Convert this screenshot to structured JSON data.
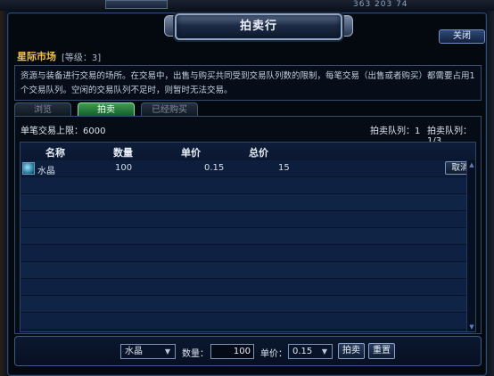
{
  "hud": {
    "values": "363   203   74"
  },
  "window": {
    "title": "拍卖行",
    "close_label": "关闭"
  },
  "market": {
    "title": "星际市场",
    "level": "[等级：3]",
    "description": "资源与装备进行交易的场所。在交易中，出售与购买共同受到交易队列数的限制，每笔交易（出售或者购买）都需要占用1个交易队列。空闲的交易队列不足时，则暂时无法交易。"
  },
  "tabs": [
    {
      "label": "浏览",
      "active": false
    },
    {
      "label": "拍卖",
      "active": true
    },
    {
      "label": "已经购买",
      "active": false
    }
  ],
  "panel": {
    "limit_label": "单笔交易上限：6000",
    "queue1": "拍卖队列：1",
    "queue2": "拍卖队列：1/3"
  },
  "table": {
    "headers": {
      "name": "名称",
      "quantity": "数量",
      "unit_price": "单价",
      "total": "总价"
    },
    "rows": [
      {
        "icon": "crystal-icon",
        "name": "水晶",
        "quantity": "100",
        "unit_price": "0.15",
        "total": "15",
        "action": "取消"
      }
    ]
  },
  "controls": {
    "item_select": "水晶",
    "quantity_label": "数量：",
    "quantity_value": "100",
    "price_label": "单价：",
    "price_select": "0.15",
    "auction_button": "拍卖",
    "reset_button": "重置"
  },
  "colors": {
    "accent_gold": "#f4c04a",
    "active_tab": "#3e9b52",
    "panel_border": "#344c6e"
  }
}
